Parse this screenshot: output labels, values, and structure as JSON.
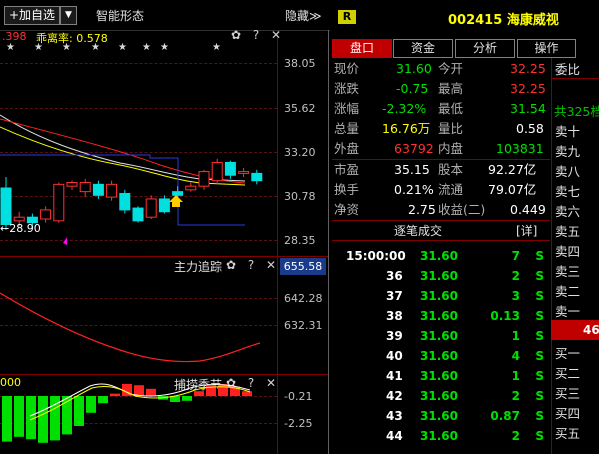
{
  "toolbar": {
    "add_label": "+加自选",
    "dropdown_glyph": "▼",
    "menu_shape": "智能形态",
    "menu_hide": "隐藏≫"
  },
  "indicator": {
    "left_value": ".398",
    "label": "乖离率: 0.578"
  },
  "main_chart": {
    "price_ticks": [
      "38.05",
      "35.62",
      "33.20",
      "30.78",
      "28.35"
    ],
    "low_label": "←28.90",
    "candles": [
      {
        "o": 31.2,
        "c": 29.2,
        "h": 31.8,
        "l": 28.9,
        "up": false
      },
      {
        "o": 29.4,
        "c": 29.6,
        "h": 29.9,
        "l": 29.1,
        "up": true
      },
      {
        "o": 29.6,
        "c": 29.3,
        "h": 29.8,
        "l": 29.0,
        "up": false
      },
      {
        "o": 29.5,
        "c": 30.0,
        "h": 30.2,
        "l": 29.3,
        "up": true
      },
      {
        "o": 29.4,
        "c": 31.4,
        "h": 31.5,
        "l": 29.3,
        "up": true
      },
      {
        "o": 31.3,
        "c": 31.5,
        "h": 31.6,
        "l": 31.1,
        "up": true
      },
      {
        "o": 31.0,
        "c": 31.5,
        "h": 31.7,
        "l": 30.7,
        "up": true
      },
      {
        "o": 31.4,
        "c": 30.8,
        "h": 31.6,
        "l": 30.6,
        "up": false
      },
      {
        "o": 30.7,
        "c": 31.4,
        "h": 31.6,
        "l": 30.5,
        "up": true
      },
      {
        "o": 30.9,
        "c": 30.0,
        "h": 31.1,
        "l": 29.8,
        "up": false
      },
      {
        "o": 30.1,
        "c": 29.4,
        "h": 30.2,
        "l": 29.3,
        "up": false
      },
      {
        "o": 29.6,
        "c": 30.6,
        "h": 30.8,
        "l": 29.5,
        "up": true
      },
      {
        "o": 30.6,
        "c": 29.9,
        "h": 30.8,
        "l": 29.8,
        "up": false
      },
      {
        "o": 31.0,
        "c": 30.8,
        "h": 31.3,
        "l": 30.2,
        "up": false
      },
      {
        "o": 31.1,
        "c": 31.3,
        "h": 31.5,
        "l": 31.0,
        "up": true
      },
      {
        "o": 31.3,
        "c": 32.1,
        "h": 32.2,
        "l": 31.1,
        "up": true
      },
      {
        "o": 31.6,
        "c": 32.6,
        "h": 32.8,
        "l": 31.4,
        "up": true
      },
      {
        "o": 32.6,
        "c": 31.9,
        "h": 32.7,
        "l": 31.7,
        "up": false
      },
      {
        "o": 32.0,
        "c": 32.1,
        "h": 32.3,
        "l": 31.8,
        "up": true
      },
      {
        "o": 32.0,
        "c": 31.6,
        "h": 32.2,
        "l": 31.4,
        "up": false
      }
    ]
  },
  "panel2": {
    "title": "主力追踪",
    "value_box": "655.58",
    "ticks": [
      "642.28",
      "632.31"
    ]
  },
  "panel3": {
    "title": "捕捞季节",
    "left_value": "000",
    "ticks": [
      "-0.21",
      "-2.25"
    ],
    "bars": [
      -3.8,
      -3.4,
      -3.6,
      -3.9,
      -3.7,
      -3.2,
      -2.5,
      -1.4,
      -0.6,
      0.2,
      1.0,
      0.9,
      0.6,
      -0.3,
      -0.5,
      -0.4,
      0.4,
      0.9,
      1.0,
      0.8,
      0.4
    ]
  },
  "panel_icons": "✿ ? ✕",
  "stock": {
    "badge": "R",
    "code": "002415",
    "name": "海康威视"
  },
  "tabs": [
    "盘口",
    "资金",
    "分析",
    "操作"
  ],
  "quote": {
    "now_label": "现价",
    "now_value": "31.60",
    "open_label": "今开",
    "open_value": "32.25",
    "change_label": "涨跌",
    "change_value": "-0.75",
    "high_label": "最高",
    "high_value": "32.25",
    "pct_label": "涨幅",
    "pct_value": "-2.32%",
    "low_label": "最低",
    "low_value": "31.54",
    "vol_label": "总量",
    "vol_value": "16.76万",
    "ratio_label": "量比",
    "ratio_value": "0.58",
    "outer_label": "外盘",
    "outer_value": "63792",
    "inner_label": "内盘",
    "inner_value": "103831",
    "pe_label": "市盈",
    "pe_value": "35.15",
    "cap_label": "股本",
    "cap_value": "92.27亿",
    "turn_label": "换手",
    "turn_value": "0.21%",
    "float_label": "流通",
    "float_value": "79.07亿",
    "nav_label": "净资",
    "nav_value": "2.75",
    "income_label": "收益(二)",
    "income_value": "0.449"
  },
  "trades": {
    "title": "逐笔成交",
    "detail": "[详]",
    "rows": [
      {
        "time": "15:00:00",
        "price": "31.60",
        "vol": "7",
        "side": "S"
      },
      {
        "time": "36",
        "price": "31.60",
        "vol": "2",
        "side": "S"
      },
      {
        "time": "37",
        "price": "31.60",
        "vol": "3",
        "side": "S"
      },
      {
        "time": "38",
        "price": "31.60",
        "vol": "0.13",
        "side": "S"
      },
      {
        "time": "39",
        "price": "31.60",
        "vol": "1",
        "side": "S"
      },
      {
        "time": "40",
        "price": "31.60",
        "vol": "4",
        "side": "S"
      },
      {
        "time": "41",
        "price": "31.60",
        "vol": "1",
        "side": "S"
      },
      {
        "time": "42",
        "price": "31.60",
        "vol": "2",
        "side": "S"
      },
      {
        "time": "43",
        "price": "31.60",
        "vol": "0.87",
        "side": "S"
      },
      {
        "time": "44",
        "price": "31.60",
        "vol": "2",
        "side": "S"
      }
    ]
  },
  "order_book": {
    "header": "委比",
    "total": "共325档",
    "sells": [
      "卖十",
      "卖九",
      "卖八",
      "卖七",
      "卖六",
      "卖五",
      "卖四",
      "卖三",
      "卖二",
      "卖一"
    ],
    "buys": [
      "买一",
      "买二",
      "买三",
      "买四",
      "买五"
    ],
    "sell_badge": "46"
  },
  "colors": {
    "up": "#ff3030",
    "down": "#00e0e0",
    "accent": "#ffff00"
  }
}
